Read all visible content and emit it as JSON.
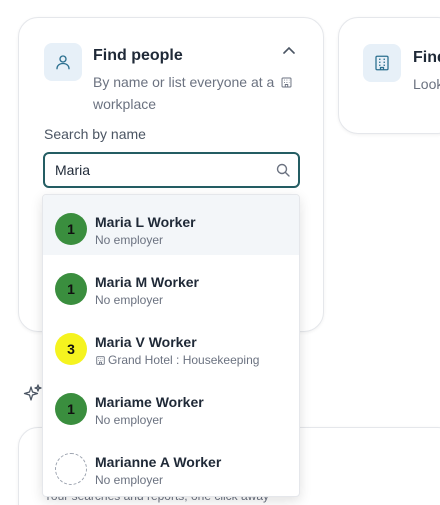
{
  "find_people": {
    "title": "Find people",
    "desc_before": "By name or list everyone at a",
    "desc_after": "workplace",
    "search_label": "Search by name",
    "search_value": "Maria"
  },
  "side_card": {
    "title": "Find",
    "desc": "Look"
  },
  "bottom_card": {
    "subtitle": "Your searches and reports, one click away"
  },
  "results": [
    {
      "name": "Maria L Worker",
      "sub": "No employer",
      "badge": "1",
      "badge_color": "#3a8e3e"
    },
    {
      "name": "Maria M Worker",
      "sub": "No employer",
      "badge": "1",
      "badge_color": "#3a8e3e"
    },
    {
      "name": "Maria V Worker",
      "sub": "Grand Hotel : Housekeeping",
      "sub_icon": "building-icon",
      "badge": "3",
      "badge_color": "#f5f31f"
    },
    {
      "name": "Mariame Worker",
      "sub": "No employer",
      "badge": "1",
      "badge_color": "#3a8e3e"
    },
    {
      "name": "Marianne A Worker",
      "sub": "No employer",
      "badge": "",
      "badge_color": "none"
    }
  ]
}
